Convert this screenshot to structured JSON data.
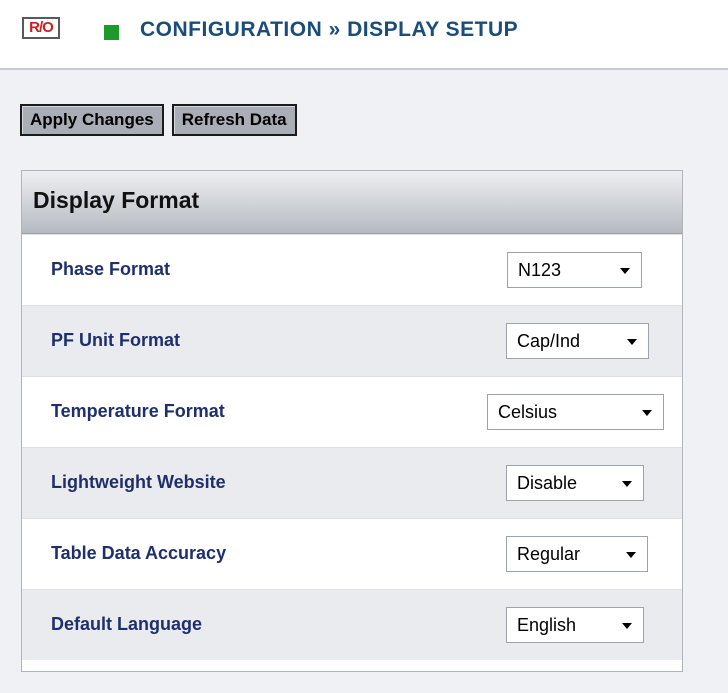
{
  "header": {
    "badge": "R/O",
    "title": "CONFIGURATION » DISPLAY SETUP",
    "status_color": "#1e9a2c"
  },
  "toolbar": {
    "apply_label": "Apply Changes",
    "refresh_label": "Refresh Data"
  },
  "panel": {
    "title": "Display Format",
    "rows": [
      {
        "label": "Phase Format",
        "value": "N123"
      },
      {
        "label": "PF Unit Format",
        "value": "Cap/Ind"
      },
      {
        "label": "Temperature Format",
        "value": "Celsius"
      },
      {
        "label": "Lightweight Website",
        "value": "Disable"
      },
      {
        "label": "Table Data Accuracy",
        "value": "Regular"
      },
      {
        "label": "Default Language",
        "value": "English"
      }
    ]
  }
}
